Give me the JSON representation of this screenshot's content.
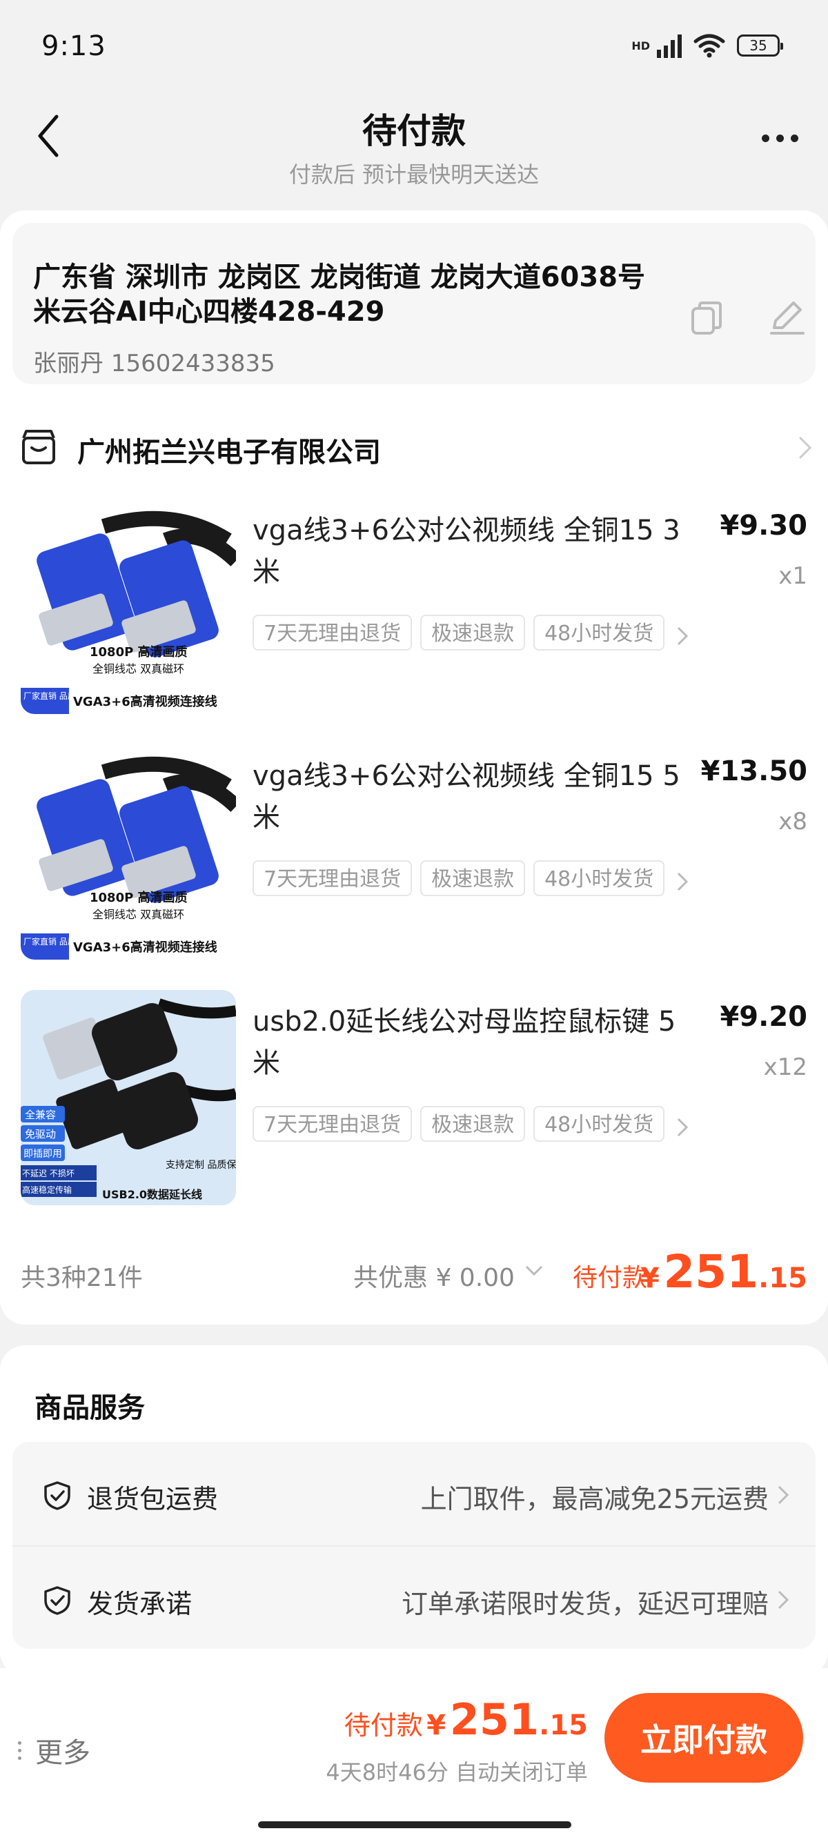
{
  "status_bar": {
    "time": "9:13",
    "network": "HD",
    "battery": "35"
  },
  "header": {
    "title": "待付款",
    "subtitle": "付款后 预计最快明天送达"
  },
  "address": {
    "line": "广东省 深圳市 龙岗区 龙岗街道 龙岗大道6038号米云谷AI中心四楼428-429",
    "contact": "张丽丹 15602433835"
  },
  "shop": {
    "name": "广州拓兰兴电子有限公司"
  },
  "items": [
    {
      "title": "vga线3+6公对公视频线 全铜15 3米",
      "price": "¥9.30",
      "qty": "x1",
      "tags": [
        "7天无理由退货",
        "极速退款",
        "48小时发货"
      ],
      "thumb": {
        "top_text": "1080P 高清画质",
        "sub_text": "全铜线芯 双真磁环",
        "badge": "厂家直销 品质保证",
        "bottom_text": "VGA3+6高清视频连接线"
      }
    },
    {
      "title": "vga线3+6公对公视频线 全铜15 5米",
      "price": "¥13.50",
      "qty": "x8",
      "tags": [
        "7天无理由退货",
        "极速退款",
        "48小时发货"
      ],
      "thumb": {
        "top_text": "1080P 高清画质",
        "sub_text": "全铜线芯 双真磁环",
        "badge": "厂家直销 品质保证",
        "bottom_text": "VGA3+6高清视频连接线"
      }
    },
    {
      "title": "usb2.0延长线公对母监控鼠标键 5米",
      "price": "¥9.20",
      "qty": "x12",
      "tags": [
        "7天无理由退货",
        "极速退款",
        "48小时发货"
      ],
      "thumb": {
        "labels": [
          "全兼容",
          "免驱动",
          "即插即用",
          "不延迟 不损坏",
          "高速稳定传输"
        ],
        "right_text": "支持定制 品质保证",
        "bottom_text": "USB2.0数据延长线"
      }
    }
  ],
  "summary": {
    "count": "共3种21件",
    "discount": "共优惠 ¥ 0.00",
    "pay_label": "待付款",
    "currency": "¥",
    "amount_int": "251",
    "amount_dec": ".15"
  },
  "services": {
    "title": "商品服务",
    "rows": [
      {
        "label": "退货包运费",
        "value": "上门取件，最高减免25元运费"
      },
      {
        "label": "发货承诺",
        "value": "订单承诺限时发货，延迟可理赔"
      }
    ]
  },
  "bottom_bar": {
    "more_label": "更多",
    "pay_label": "待付款",
    "currency": "¥",
    "amount_int": "251",
    "amount_dec": ".15",
    "countdown": "4天8时46分 自动关闭订单",
    "pay_button": "立即付款"
  },
  "colors": {
    "accent": "#ff4f1f",
    "button": "#ff5a1f",
    "background": "#f2f2f2"
  }
}
